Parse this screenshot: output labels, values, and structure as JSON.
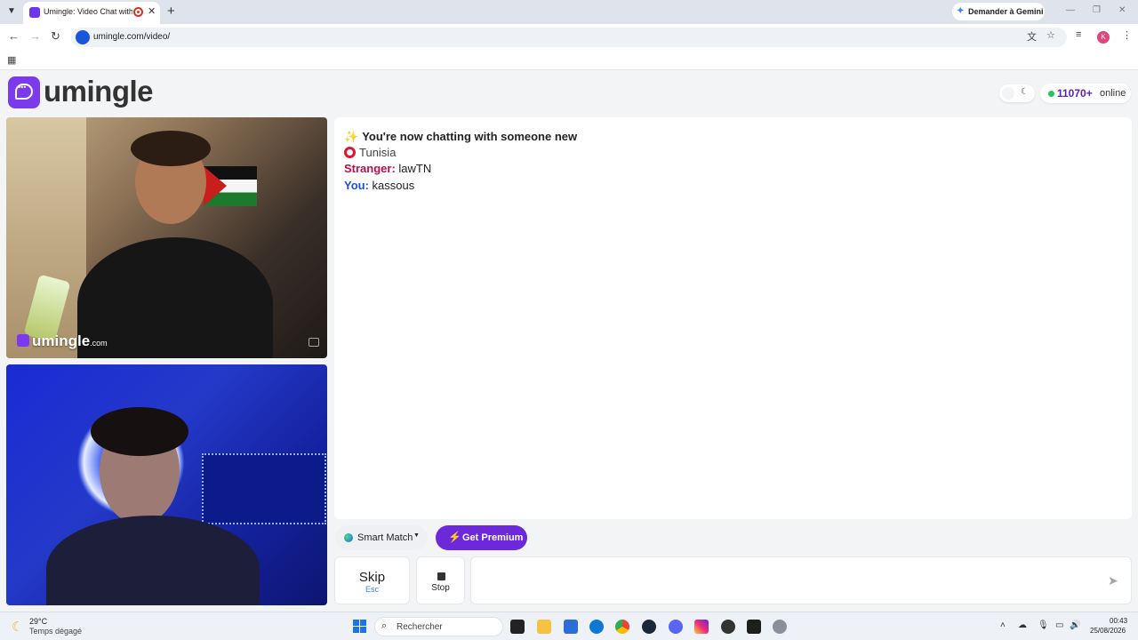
{
  "browser": {
    "tab_title": "Umingle: Video Chat with Strangers",
    "url": "umingle.com/video/",
    "gemini_label": "Demander à Gemini",
    "profile_initial": "K"
  },
  "site": {
    "brand": "umingle",
    "online_count": "11070+",
    "online_label": "online"
  },
  "video": {
    "watermark": "umingle",
    "watermark_suffix": ".com"
  },
  "chat": {
    "status": "You're now chatting with someone new",
    "country": "Tunisia",
    "stranger_label": "Stranger:",
    "stranger_name": "lawTN",
    "you_label": "You:",
    "you_message": "kassous"
  },
  "controls": {
    "smart_match": "Smart Match",
    "premium": "Get Premium",
    "skip": "Skip",
    "skip_hint": "Esc",
    "stop": "Stop",
    "message_placeholder": ""
  },
  "taskbar": {
    "temperature": "29°C",
    "weather": "Temps dégagé",
    "search": "Rechercher",
    "time": "00:43",
    "date": "25/08/2026"
  },
  "colors": {
    "brand_purple": "#7c3aed",
    "premium": "#6d28d9",
    "stranger": "#b80f4a",
    "you": "#1e4fd8",
    "online_dot": "#22c55e"
  }
}
